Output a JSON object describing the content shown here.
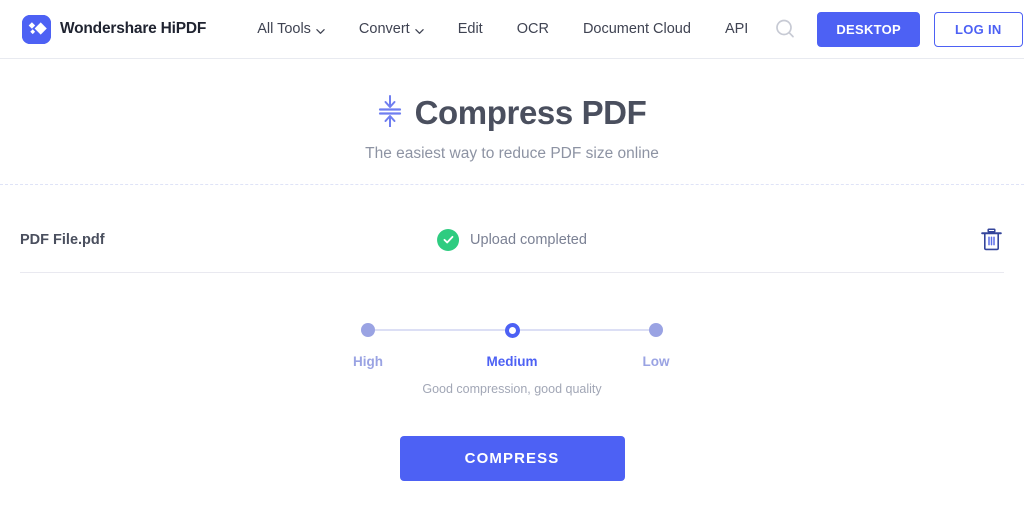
{
  "navbar": {
    "brand": {
      "name": "Wondershare HiPDF",
      "logo_icon": "diamonds-logo-icon",
      "logo_color": "#4d61f4"
    },
    "links": [
      {
        "label": "All Tools",
        "has_chevron": true,
        "icon": "chevron-down-icon"
      },
      {
        "label": "Convert",
        "has_chevron": true,
        "icon": "chevron-down-icon"
      },
      {
        "label": "Edit",
        "has_chevron": false,
        "icon": ""
      },
      {
        "label": "OCR",
        "has_chevron": false,
        "icon": ""
      },
      {
        "label": "Document Cloud",
        "has_chevron": false,
        "icon": ""
      },
      {
        "label": "API",
        "has_chevron": false,
        "icon": ""
      }
    ],
    "search_icon": "search-icon",
    "desktop_button": "DESKTOP",
    "login_button": "LOG IN"
  },
  "hero": {
    "icon": "compress-icon",
    "title": "Compress PDF",
    "subtitle": "The easiest way to reduce PDF size online"
  },
  "file": {
    "name": "PDF File.pdf",
    "status": "Upload completed",
    "status_icon": "check-circle-icon",
    "status_color": "#2ecc80",
    "delete_icon": "trash-icon"
  },
  "compression": {
    "options": [
      {
        "label": "High",
        "selected": false
      },
      {
        "label": "Medium",
        "selected": true
      },
      {
        "label": "Low",
        "selected": false
      }
    ],
    "selected_label": "Medium",
    "hint": "Good compression, good quality",
    "accent_color": "#4d61f4",
    "inactive_color": "#9aa3e3"
  },
  "action": {
    "compress_button": "COMPRESS"
  }
}
